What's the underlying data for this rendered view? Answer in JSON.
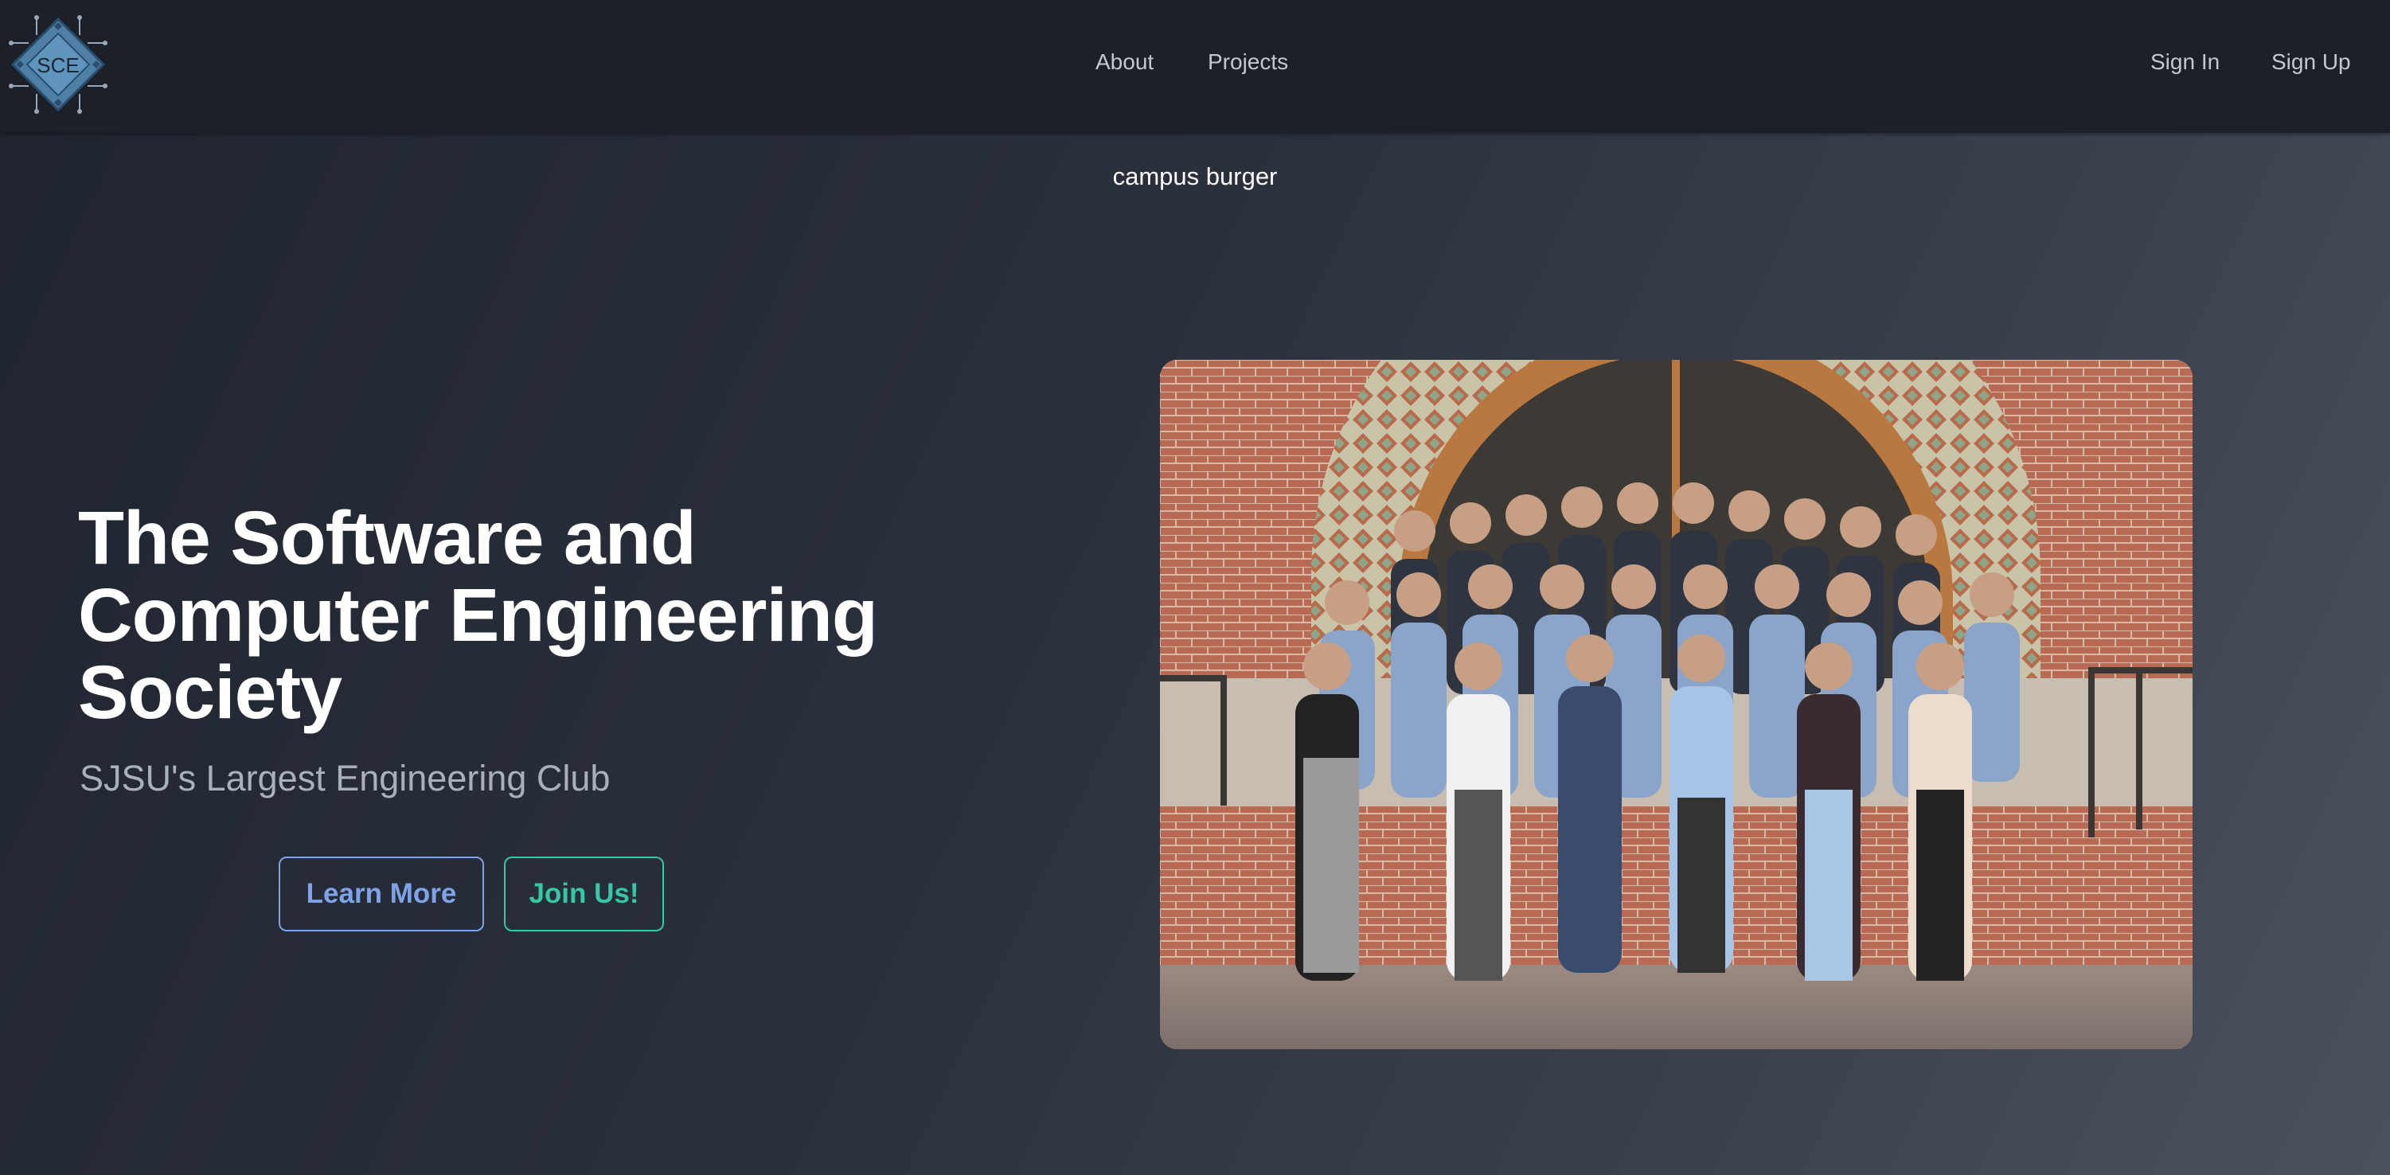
{
  "navbar": {
    "logo_text": "SCE",
    "links": {
      "about": "About",
      "projects": "Projects"
    },
    "auth": {
      "sign_in": "Sign In",
      "sign_up": "Sign Up"
    }
  },
  "announcement": {
    "text": "campus burger"
  },
  "hero": {
    "title": "The Software and Computer Engineering Society",
    "subtitle": "SJSU's Largest Engineering Club",
    "buttons": {
      "learn_more": "Learn More",
      "join_us": "Join Us!"
    },
    "image": {
      "alt": "group photo"
    }
  },
  "colors": {
    "navbar_bg": "#1c2028",
    "learn_more_accent": "#7ea3e8",
    "join_us_accent": "#36c7a8",
    "subtitle": "#aab0b9"
  }
}
